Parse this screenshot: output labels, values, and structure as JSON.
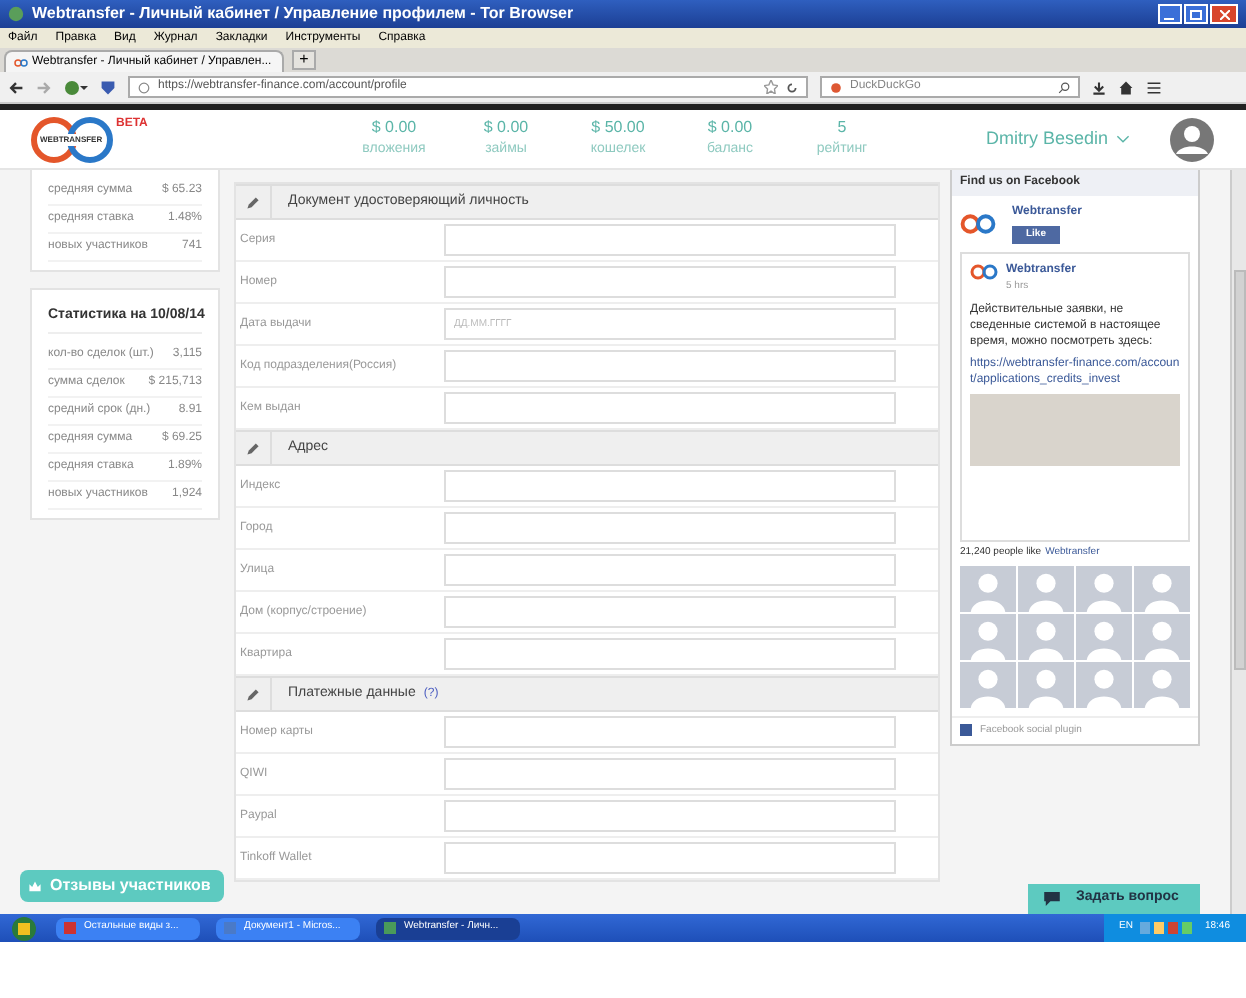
{
  "window": {
    "title": "Webtransfer - Личный кабинет / Управление профилем - Tor Browser"
  },
  "menu": [
    "Файл",
    "Правка",
    "Вид",
    "Журнал",
    "Закладки",
    "Инструменты",
    "Справка"
  ],
  "tabs": [
    {
      "label": "Webtransfer - Личный кабинет / Управлен...",
      "selected": true
    }
  ],
  "new_tab": "+",
  "address": {
    "value": "https://webtransfer-finance.com/account/profile"
  },
  "search": {
    "placeholder": "DuckDuckGo"
  },
  "site_header": {
    "logo": "WEBTRANSFER",
    "badge": "BETA",
    "stats": [
      {
        "value": "$ 0.00",
        "label": "вложения"
      },
      {
        "value": "$ 0.00",
        "label": "займы"
      },
      {
        "value": "$ 50.00",
        "label": "кошелек"
      },
      {
        "value": "$ 0.00",
        "label": "баланс"
      },
      {
        "value": "5",
        "label": "рейтинг"
      }
    ],
    "user": "Dmitry Besedin"
  },
  "sidebar": [
    {
      "rows": [
        {
          "label": "средняя сумма",
          "value": "$ 65.23"
        },
        {
          "label": "средняя ставка",
          "value": "1.48%"
        },
        {
          "label": "новых участников",
          "value": "741"
        }
      ]
    },
    {
      "title": "Статистика на 10/08/14",
      "rows": [
        {
          "label": "кол-во сделок (шт.)",
          "value": "3,115"
        },
        {
          "label": "сумма сделок",
          "value": "$ 215,713"
        },
        {
          "label": "средний срок (дн.)",
          "value": "8.91"
        },
        {
          "label": "средняя сумма",
          "value": "$ 69.25"
        },
        {
          "label": "средняя ставка",
          "value": "1.89%"
        },
        {
          "label": "новых участников",
          "value": "1,924"
        }
      ]
    }
  ],
  "form_sections": [
    {
      "title": "Документ удостоверяющий личность",
      "fields": [
        {
          "label": "Серия"
        },
        {
          "label": "Номер"
        },
        {
          "label": "Дата выдачи",
          "placeholder": "ДД.ММ.ГГГГ"
        },
        {
          "label": "Код подразделения(Россия)"
        },
        {
          "label": "Кем выдан"
        }
      ]
    },
    {
      "title": "Адрес",
      "fields": [
        {
          "label": "Индекс"
        },
        {
          "label": "Город"
        },
        {
          "label": "Улица"
        },
        {
          "label": "Дом (корпус/строение)"
        },
        {
          "label": "Квартира"
        }
      ]
    },
    {
      "title": "Платежные данные",
      "help": "(?)",
      "fields": [
        {
          "label": "Номер карты"
        },
        {
          "label": "QIWI"
        },
        {
          "label": "Paypal"
        },
        {
          "label": "Tinkoff Wallet"
        }
      ]
    }
  ],
  "facebook": {
    "heading": "Find us on Facebook",
    "page": "Webtransfer",
    "like": "Like",
    "post": {
      "author": "Webtransfer",
      "time": "5 hrs",
      "text": "Действительные заявки, не сведенные системой в настоящее время, можно посмотреть здесь:",
      "link": "https://webtransfer-finance.com/account/applications_credits_invest"
    },
    "likes_text": "21,240 people like",
    "likes_link": "Webtransfer",
    "footer": "Facebook social plugin"
  },
  "reviews_button": "Отзывы участников",
  "ask_button": "Задать вопрос",
  "taskbar": {
    "items": [
      {
        "label": "Остальные виды з...",
        "selected": false
      },
      {
        "label": "Документ1 - Micros...",
        "selected": false
      },
      {
        "label": "Webtransfer - Личн...",
        "selected": true
      }
    ],
    "lang": "EN",
    "time": "18:46"
  }
}
